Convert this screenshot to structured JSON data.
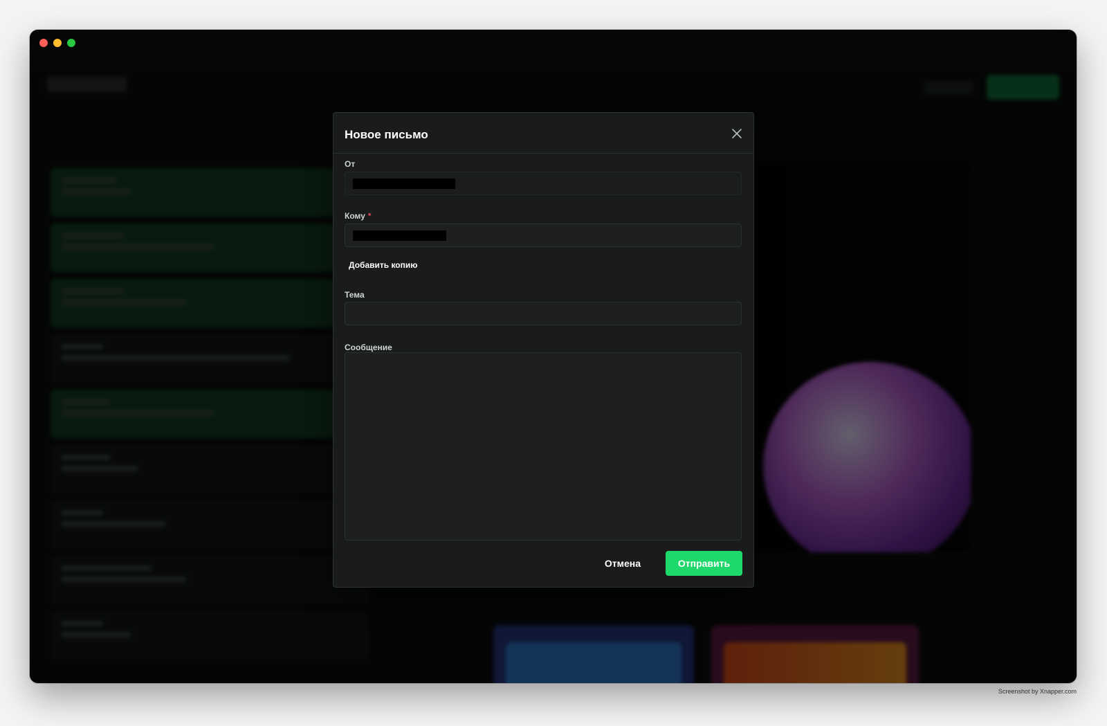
{
  "modal": {
    "title": "Новое письмо",
    "from_label": "От",
    "to_label": "Кому",
    "required_mark": "*",
    "add_copy_label": "Добавить копию",
    "subject_label": "Тема",
    "subject_value": "",
    "message_label": "Сообщение",
    "message_value": "",
    "cancel_label": "Отмена",
    "send_label": "Отправить"
  },
  "colors": {
    "accent": "#1fd86b",
    "required": "#e0475b",
    "modal_bg": "#1a1c1b"
  },
  "icons": {
    "close": "close-icon"
  },
  "footer": {
    "watermark": "Screenshot by Xnapper.com"
  }
}
